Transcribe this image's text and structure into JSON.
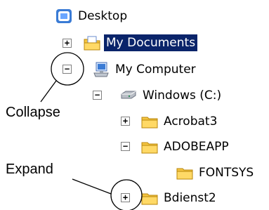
{
  "tree": {
    "nodes": [
      {
        "label": "Desktop",
        "icon": "desktop-icon"
      },
      {
        "label": "My Documents",
        "icon": "my-documents-icon",
        "expander": "+",
        "selected": true
      },
      {
        "label": "My Computer",
        "icon": "my-computer-icon",
        "expander": "−"
      },
      {
        "label": "Windows (C:)",
        "icon": "drive-icon",
        "expander": "−"
      },
      {
        "label": "Acrobat3",
        "icon": "folder-icon",
        "expander": "+"
      },
      {
        "label": "ADOBEAPP",
        "icon": "folder-icon",
        "expander": "−"
      },
      {
        "label": "FONTSYS",
        "icon": "folder-icon"
      },
      {
        "label": "Bdienst2",
        "icon": "folder-icon",
        "expander": "+"
      }
    ]
  },
  "callouts": {
    "collapse": "Collapse",
    "expand": "Expand"
  },
  "colors": {
    "selection": "#0a246a",
    "folder": "#f5c542"
  }
}
